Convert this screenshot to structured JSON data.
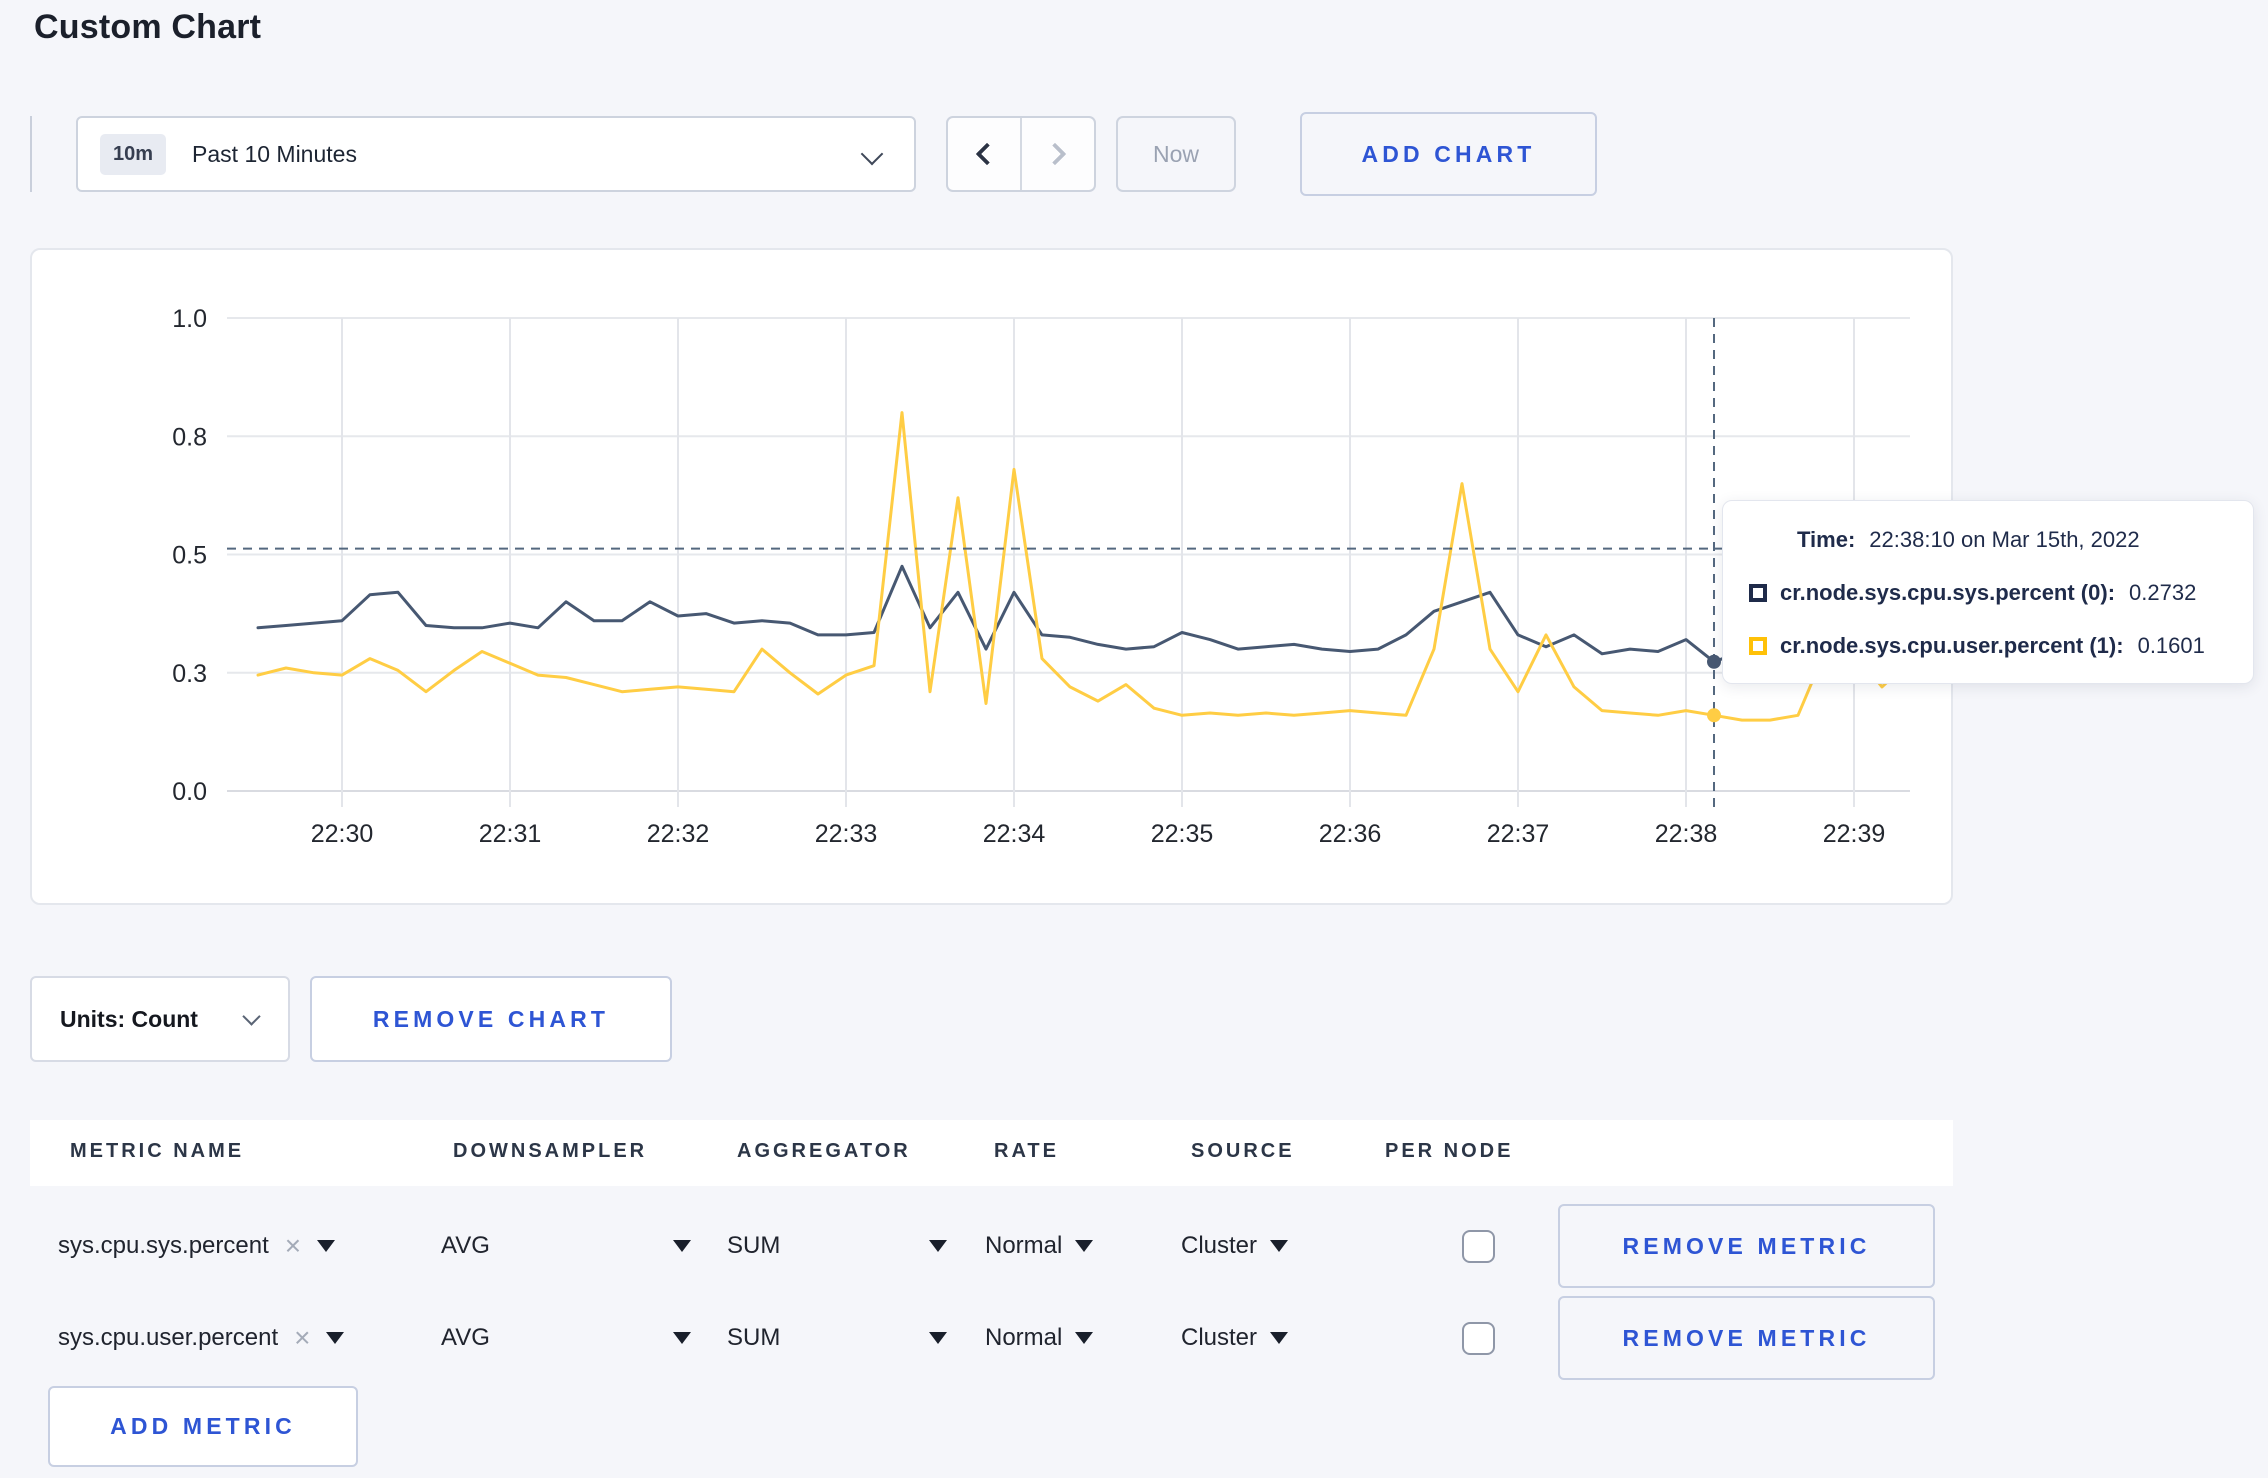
{
  "page": {
    "title": "Custom Chart",
    "background": "#f5f6fa",
    "accent_blue": "#2e55d4"
  },
  "toolbar": {
    "time_range_badge": "10m",
    "time_range_label": "Past 10 Minutes",
    "now_label": "Now",
    "add_chart_label": "ADD CHART"
  },
  "chart_data": {
    "type": "line",
    "title": "",
    "xlabel": "",
    "ylabel": "",
    "ylim": [
      0,
      1
    ],
    "grid": true,
    "y_ticks": [
      "1.0",
      "0.8",
      "0.5",
      "0.3",
      "0.0"
    ],
    "x_ticks": [
      "22:30",
      "22:31",
      "22:32",
      "22:33",
      "22:34",
      "22:35",
      "22:36",
      "22:37",
      "22:38",
      "22:39"
    ],
    "x_start_offset_minutes": -0.5,
    "x_interval_seconds": 10,
    "series": [
      {
        "name": "cr.node.sys.cpu.sys.percent (0)",
        "color": "#475872",
        "values": [
          0.345,
          0.35,
          0.355,
          0.36,
          0.415,
          0.42,
          0.35,
          0.345,
          0.345,
          0.355,
          0.345,
          0.4,
          0.36,
          0.36,
          0.4,
          0.37,
          0.375,
          0.355,
          0.36,
          0.355,
          0.33,
          0.33,
          0.335,
          0.475,
          0.345,
          0.42,
          0.3,
          0.42,
          0.33,
          0.325,
          0.31,
          0.3,
          0.305,
          0.335,
          0.32,
          0.3,
          0.305,
          0.31,
          0.3,
          0.295,
          0.3,
          0.33,
          0.38,
          0.4,
          0.42,
          0.33,
          0.305,
          0.33,
          0.29,
          0.3,
          0.295,
          0.32,
          0.2732,
          0.295,
          0.31,
          0.33,
          0.3,
          0.305,
          0.3,
          0.315
        ]
      },
      {
        "name": "cr.node.sys.cpu.user.percent (1)",
        "color": "#ffcd44",
        "values": [
          0.245,
          0.26,
          0.25,
          0.245,
          0.28,
          0.255,
          0.21,
          0.255,
          0.295,
          0.27,
          0.245,
          0.24,
          0.225,
          0.21,
          0.215,
          0.22,
          0.215,
          0.21,
          0.3,
          0.25,
          0.205,
          0.245,
          0.265,
          0.8,
          0.21,
          0.62,
          0.185,
          0.68,
          0.28,
          0.22,
          0.19,
          0.225,
          0.175,
          0.16,
          0.165,
          0.16,
          0.165,
          0.16,
          0.165,
          0.17,
          0.165,
          0.16,
          0.3,
          0.65,
          0.3,
          0.21,
          0.33,
          0.22,
          0.17,
          0.165,
          0.16,
          0.17,
          0.1601,
          0.15,
          0.15,
          0.16,
          0.3,
          0.295,
          0.22,
          0.275
        ]
      }
    ],
    "crosshair": {
      "x_minutes": 8.1667,
      "y_value": 0.5125
    },
    "hover_points": [
      {
        "value": 0.2732
      },
      {
        "value": 0.1601
      }
    ],
    "legend_position": "tooltip"
  },
  "tooltip": {
    "time_label": "Time:",
    "time_value": "22:38:10 on Mar 15th, 2022",
    "rows": [
      {
        "label": "cr.node.sys.cpu.sys.percent (0):",
        "value": "0.2732",
        "color": "#1f2b4a"
      },
      {
        "label": "cr.node.sys.cpu.user.percent (1):",
        "value": "0.1601",
        "color": "#ffc107"
      }
    ]
  },
  "chart_controls": {
    "units_label": "Units: Count",
    "remove_chart_label": "REMOVE CHART"
  },
  "metrics_table": {
    "headers": [
      "METRIC NAME",
      "DOWNSAMPLER",
      "AGGREGATOR",
      "RATE",
      "SOURCE",
      "PER NODE"
    ],
    "remove_tag_icon": "×",
    "rows": [
      {
        "metric": "sys.cpu.sys.percent",
        "downsampler": "AVG",
        "aggregator": "SUM",
        "rate": "Normal",
        "source": "Cluster",
        "per_node_checked": false,
        "remove_label": "REMOVE METRIC"
      },
      {
        "metric": "sys.cpu.user.percent",
        "downsampler": "AVG",
        "aggregator": "SUM",
        "rate": "Normal",
        "source": "Cluster",
        "per_node_checked": false,
        "remove_label": "REMOVE METRIC"
      }
    ],
    "add_metric_label": "ADD METRIC"
  }
}
